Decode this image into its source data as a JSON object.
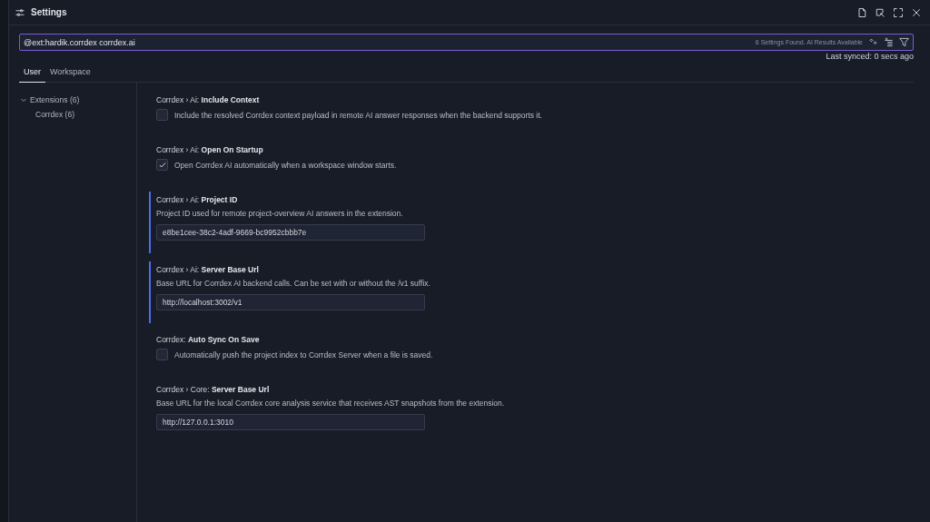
{
  "window": {
    "title": "Settings"
  },
  "search": {
    "value": "@ext:hardik.corrdex corrdex.ai",
    "results": "6 Settings Found. AI Results Available"
  },
  "tabs": [
    {
      "label": "User",
      "selected": true
    },
    {
      "label": "Workspace",
      "selected": false
    }
  ],
  "last_synced": "Last synced: 0 secs ago",
  "tree": [
    {
      "label": "Extensions (6)",
      "expanded": true,
      "children": [
        {
          "label": "Corrdex (6)"
        }
      ]
    }
  ],
  "settings": [
    {
      "kind": "checkbox",
      "category": "Corrdex › Ai: ",
      "name": "Include Context",
      "description": "Include the resolved Corrdex context payload in remote AI answer responses when the backend supports it.",
      "checked": false,
      "modified": false
    },
    {
      "kind": "checkbox",
      "category": "Corrdex › Ai: ",
      "name": "Open On Startup",
      "description": "Open Corrdex AI automatically when a workspace window starts.",
      "checked": true,
      "modified": false
    },
    {
      "kind": "text",
      "category": "Corrdex › Ai: ",
      "name": "Project ID",
      "description": "Project ID used for remote project-overview AI answers in the extension.",
      "value": "e8be1cee-38c2-4adf-9669-bc9952cbbb7e",
      "modified": true
    },
    {
      "kind": "text",
      "category": "Corrdex › Ai: ",
      "name": "Server Base Url",
      "description": "Base URL for Corrdex AI backend calls. Can be set with or without the /v1 suffix.",
      "value": "http://localhost:3002/v1",
      "modified": true
    },
    {
      "kind": "checkbox",
      "category": "Corrdex: ",
      "name": "Auto Sync On Save",
      "description": "Automatically push the project index to Corrdex Server when a file is saved.",
      "checked": false,
      "modified": false
    },
    {
      "kind": "text",
      "category": "Corrdex › Core: ",
      "name": "Server Base Url",
      "description": "Base URL for the local Corrdex core analysis service that receives AST snapshots from the extension.",
      "value": "http://127.0.0.1:3010",
      "modified": false
    }
  ]
}
